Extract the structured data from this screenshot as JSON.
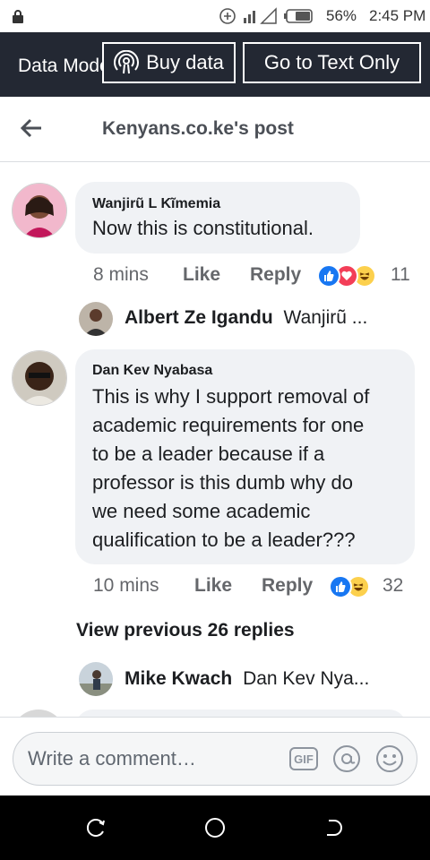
{
  "status_bar": {
    "battery": "56%",
    "time": "2:45 PM"
  },
  "data_bar": {
    "title": "Data Mode",
    "buy_label": "Buy data",
    "text_only_label": "Go to Text Only"
  },
  "header": {
    "title": "Kenyans.co.ke's post"
  },
  "comments": [
    {
      "author": "Wanjirũ L Kĩmemia",
      "text": "Now this is constitutional.",
      "time": "8 mins",
      "like": "Like",
      "reply": "Reply",
      "reaction_count": "11",
      "reply_preview": {
        "author": "Albert Ze Igandu",
        "snippet": "Wanjirũ ..."
      }
    },
    {
      "author": "Dan Kev Nyabasa",
      "text_lines": [
        "This is why I support removal of",
        "academic requirements for one",
        "to be a leader because if a",
        "professor is this dumb why do",
        "we need some academic",
        "qualification to be a leader???"
      ],
      "time": "10 mins",
      "like": "Like",
      "reply": "Reply",
      "reaction_count": "32",
      "view_previous": "View previous 26 replies",
      "reply_preview": {
        "author": "Mike Kwach",
        "snippet": "Dan Kev Nya..."
      }
    }
  ],
  "composer": {
    "placeholder": "Write a comment…",
    "gif": "GIF"
  },
  "colors": {
    "accent": "#1877f2",
    "love": "#f33e58",
    "dark_bar": "#232833"
  },
  "icons": [
    "lock-icon",
    "add-circle-icon",
    "signal-icon",
    "battery-icon",
    "broadcast-icon",
    "back-arrow-icon",
    "like-reaction-icon",
    "love-reaction-icon",
    "haha-reaction-icon",
    "gif-icon",
    "at-icon",
    "smiley-icon",
    "recents-icon",
    "home-icon",
    "back-nav-icon"
  ]
}
